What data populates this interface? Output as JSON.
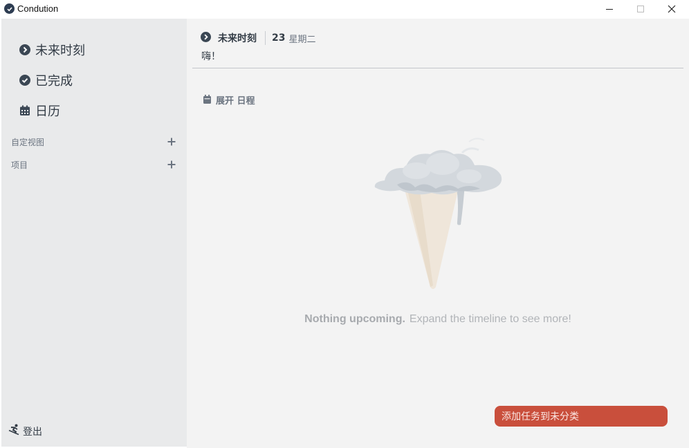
{
  "window": {
    "title": "Condution"
  },
  "sidebar": {
    "nav": [
      {
        "label": "未来时刻",
        "icon": "chevron-right-circle-icon"
      },
      {
        "label": "已完成",
        "icon": "check-circle-icon"
      },
      {
        "label": "日历",
        "icon": "calendar-icon"
      }
    ],
    "sections": [
      {
        "label": "自定视图",
        "icon": "plus-icon"
      },
      {
        "label": "项目",
        "icon": "plus-icon"
      }
    ],
    "logout_label": "登出"
  },
  "main": {
    "title": "未来时刻",
    "day": "23",
    "weekday": "星期二",
    "greeting": "嗨！",
    "expand_label": "展开 日程",
    "empty_bold": "Nothing upcoming.",
    "empty_rest": "Expand the timeline to see more!",
    "add_button_label": "添加任务到未分类"
  },
  "colors": {
    "sidebar_bg": "#e9eaeb",
    "main_bg": "#f3f3f3",
    "accent_red": "#c94f3c",
    "icon_dark": "#3b4754"
  }
}
